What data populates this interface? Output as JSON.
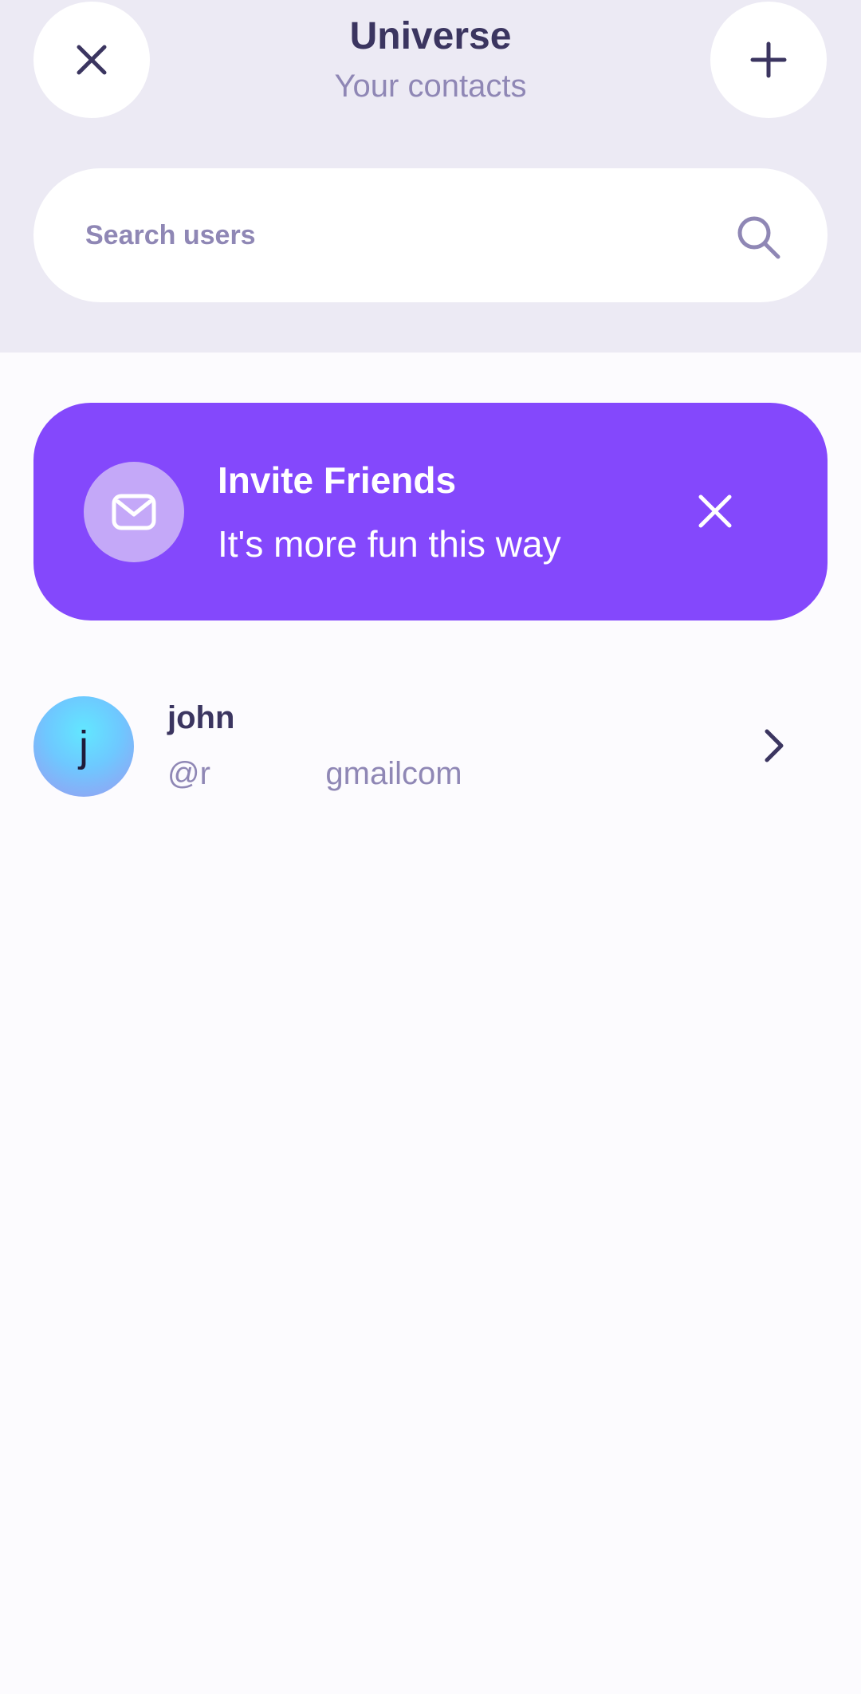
{
  "header": {
    "title": "Universe",
    "subtitle": "Your contacts"
  },
  "search": {
    "placeholder": "Search users",
    "icon": "search-icon"
  },
  "invite_banner": {
    "title": "Invite Friends",
    "subtitle": "It's more fun this way",
    "icon": "mail-icon",
    "close_icon": "close-icon"
  },
  "contacts": [
    {
      "avatar_letter": "j",
      "name": "john",
      "handle": "@r             gmailcom"
    }
  ],
  "colors": {
    "header_bg": "#eceaf4",
    "page_bg": "#fcfbfe",
    "accent": "#8448fc",
    "text_dark": "#3b3560",
    "text_muted": "#8f87b5"
  }
}
